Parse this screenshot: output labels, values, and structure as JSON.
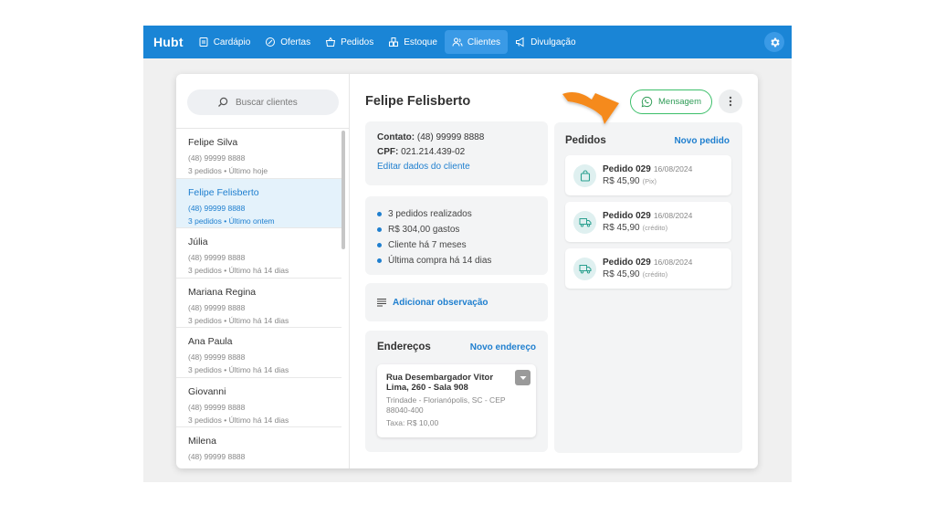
{
  "app": {
    "logo": "Hubt"
  },
  "nav": {
    "items": [
      {
        "label": "Cardápio",
        "icon": "menu-book-icon"
      },
      {
        "label": "Ofertas",
        "icon": "discount-icon"
      },
      {
        "label": "Pedidos",
        "icon": "basket-icon"
      },
      {
        "label": "Estoque",
        "icon": "boxes-icon"
      },
      {
        "label": "Clientes",
        "icon": "users-icon",
        "active": true
      },
      {
        "label": "Divulgação",
        "icon": "megaphone-icon"
      }
    ],
    "settings_icon": "gear-icon"
  },
  "search": {
    "placeholder": "Buscar clientes"
  },
  "clients": [
    {
      "name": "Felipe Silva",
      "phone": "(48) 99999 8888",
      "summary": "3 pedidos • Último hoje"
    },
    {
      "name": "Felipe Felisberto",
      "phone": "(48) 99999 8888",
      "summary": "3 pedidos • Último ontem",
      "selected": true
    },
    {
      "name": "Júlia",
      "phone": "(48) 99999 8888",
      "summary": "3 pedidos • Último há 14 dias"
    },
    {
      "name": "Mariana Regina",
      "phone": "(48) 99999 8888",
      "summary": "3 pedidos • Último há 14 dias"
    },
    {
      "name": "Ana Paula",
      "phone": "(48) 99999 8888",
      "summary": "3 pedidos • Último há 14 dias"
    },
    {
      "name": "Giovanni",
      "phone": "(48) 99999 8888",
      "summary": "3 pedidos • Último há 14 dias"
    },
    {
      "name": "Milena",
      "phone": "(48) 99999 8888",
      "summary": ""
    }
  ],
  "detail": {
    "name": "Felipe Felisberto",
    "contact_label": "Contato:",
    "contact_value": "(48) 99999 8888",
    "cpf_label": "CPF:",
    "cpf_value": "021.214.439-02",
    "edit_link": "Editar dados do cliente",
    "stats": [
      "3 pedidos realizados",
      "R$ 304,00 gastos",
      "Cliente há 7 meses",
      "Última compra há 14 dias"
    ],
    "add_note": "Adicionar observação",
    "addresses_title": "Endereços",
    "new_address": "Novo endereço",
    "address": {
      "street": "Rua Desembargador Vitor Lima, 260 - Sala 908",
      "city": "Trindade - Florianópolis, SC - CEP 88040-400",
      "fee": "Taxa: R$ 10,00"
    }
  },
  "actions": {
    "message": "Mensagem",
    "message_icon": "whatsapp-icon",
    "more_icon": "more-vertical-icon"
  },
  "orders": {
    "title": "Pedidos",
    "new_order": "Novo pedido",
    "items": [
      {
        "name": "Pedido 029",
        "date": "16/08/2024",
        "value": "R$ 45,90",
        "payment": "(Pix)",
        "icon": "bag-icon"
      },
      {
        "name": "Pedido 029",
        "date": "16/08/2024",
        "value": "R$ 45,90",
        "payment": "(crédito)",
        "icon": "delivery-truck-icon"
      },
      {
        "name": "Pedido 029",
        "date": "16/08/2024",
        "value": "R$ 45,90",
        "payment": "(crédito)",
        "icon": "delivery-truck-icon"
      }
    ]
  },
  "colors": {
    "primary": "#1a85d6",
    "link": "#1f7fcf",
    "whatsapp": "#3cbf6a",
    "arrow": "#f58a1f"
  }
}
